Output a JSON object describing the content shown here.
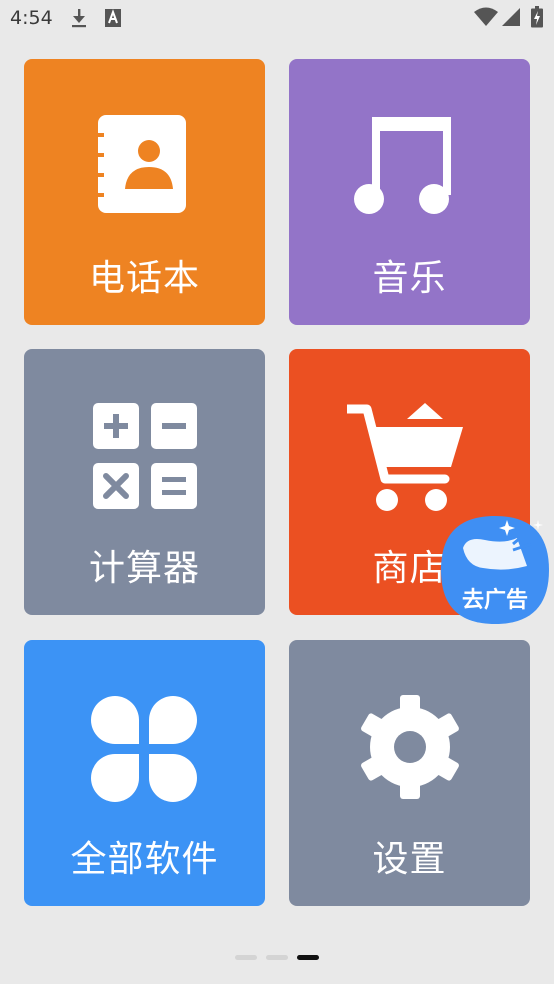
{
  "status_bar": {
    "time": "4:54",
    "left_icons": [
      "download-icon",
      "keyboard-a-icon"
    ],
    "right_icons": [
      "wifi-icon",
      "cell-signal-icon",
      "battery-charging-icon"
    ]
  },
  "tiles": [
    {
      "id": "phonebook",
      "label": "电话本",
      "icon": "contacts-book-icon",
      "color": "#EE8322"
    },
    {
      "id": "music",
      "label": "音乐",
      "icon": "music-note-icon",
      "color": "#9374C8"
    },
    {
      "id": "calculator",
      "label": "计算器",
      "icon": "calculator-icon",
      "color": "#7F8A9F"
    },
    {
      "id": "store",
      "label": "商店",
      "icon": "shopping-cart-icon",
      "color": "#EB5022"
    },
    {
      "id": "all-apps",
      "label": "全部软件",
      "icon": "app-grid-icon",
      "color": "#3C93F5"
    },
    {
      "id": "settings",
      "label": "设置",
      "icon": "gear-icon",
      "color": "#7F8A9F"
    }
  ],
  "ad_bubble": {
    "label": "去广告",
    "icon": "broom-sparkle-icon",
    "color": "#3F8FF3"
  },
  "pager": {
    "count": 3,
    "active": 3
  }
}
